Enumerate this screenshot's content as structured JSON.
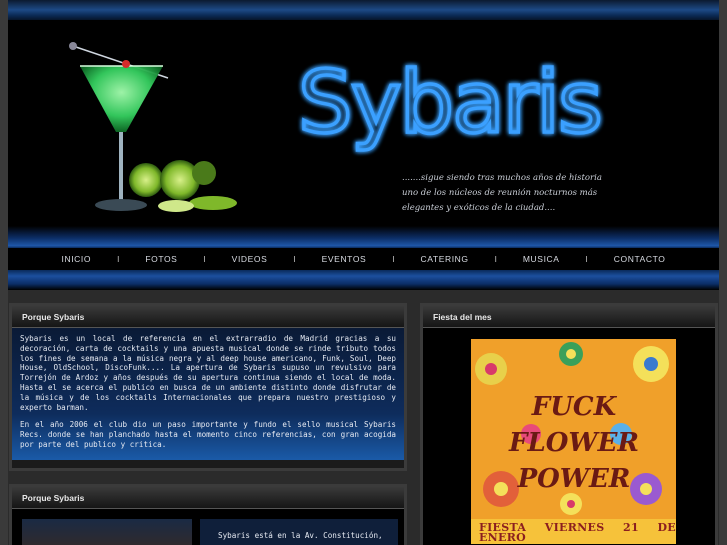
{
  "brand": {
    "name": "Sybaris",
    "tagline_line1": ".......sigue siendo tras muchos años de historia",
    "tagline_line2": "uno de los núcleos de reunión nocturnos más",
    "tagline_line3": "elegantes y exóticos de la ciudad....",
    "neon_color": "#4aa8ff",
    "accent": "#1f57a8"
  },
  "nav": {
    "items": [
      "INICIO",
      "FOTOS",
      "VIDEOS",
      "EVENTOS",
      "CATERING",
      "MUSICA",
      "CONTACTO"
    ],
    "separator": "I"
  },
  "panels": {
    "about": {
      "title": "Porque Sybaris",
      "paragraph1": "Sybaris es un local de referencia en el extrarradio de Madrid gracias a su decoración, carta de cocktails y una apuesta musical donde se rinde tributo todos los fines de semana a la música negra y al deep house americano, Funk, Soul, Deep House, OldSchool, DiscoFunk.... La apertura de Sybaris supuso un revulsivo para Torrejón de Ardoz y años después de su apertura continua siendo el local de moda. Hasta el se acerca el publico en busca de un ambiente distinto donde disfrutar de la música y de los cocktails Internacionales que prepara nuestro prestigioso y experto barman.",
      "paragraph2": "En el año 2006 el club dio un paso importante y fundo el sello musical Sybaris Recs. donde se han planchado hasta el momento cinco referencias, con gran acogida por parte del publico y critica."
    },
    "about2": {
      "title": "Porque Sybaris",
      "snippet": "Sybaris está en la Av. Constitución,"
    },
    "fiesta": {
      "title": "Fiesta del mes",
      "poster_title": "FUCK FLOWER POWER",
      "poster_date": "FIESTA VIERNES 21 DE ENERO"
    }
  },
  "icons": {
    "cocktail": "martini-glass-icon",
    "limes": "lime-slices-icon"
  }
}
